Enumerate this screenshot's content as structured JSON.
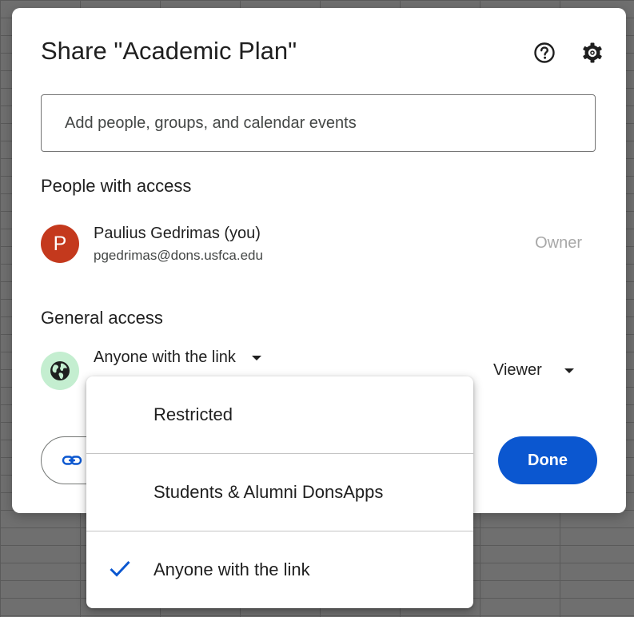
{
  "dialog": {
    "title": "Share \"Academic Plan\"",
    "help_icon": "help-circle-icon",
    "settings_icon": "gear-icon"
  },
  "search": {
    "placeholder": "Add people, groups, and calendar events",
    "value": ""
  },
  "people_with_access": {
    "heading": "People with access",
    "people": [
      {
        "avatar_initial": "P",
        "avatar_color": "#c4391d",
        "name": "Paulius Gedrimas (you)",
        "email": "pgedrimas@dons.usfca.edu",
        "role": "Owner"
      }
    ]
  },
  "general_access": {
    "heading": "General access",
    "icon": "globe-icon",
    "selected": "Anyone with the link",
    "role": "Viewer"
  },
  "footer": {
    "copy_link_icon": "link-icon",
    "done_label": "Done",
    "done_color": "#0b57d0"
  },
  "dropdown": {
    "options": [
      {
        "label": "Restricted",
        "selected": false
      },
      {
        "label": "Students & Alumni DonsApps",
        "selected": false
      },
      {
        "label": "Anyone with the link",
        "selected": true
      }
    ],
    "check_color": "#0b57d0"
  }
}
